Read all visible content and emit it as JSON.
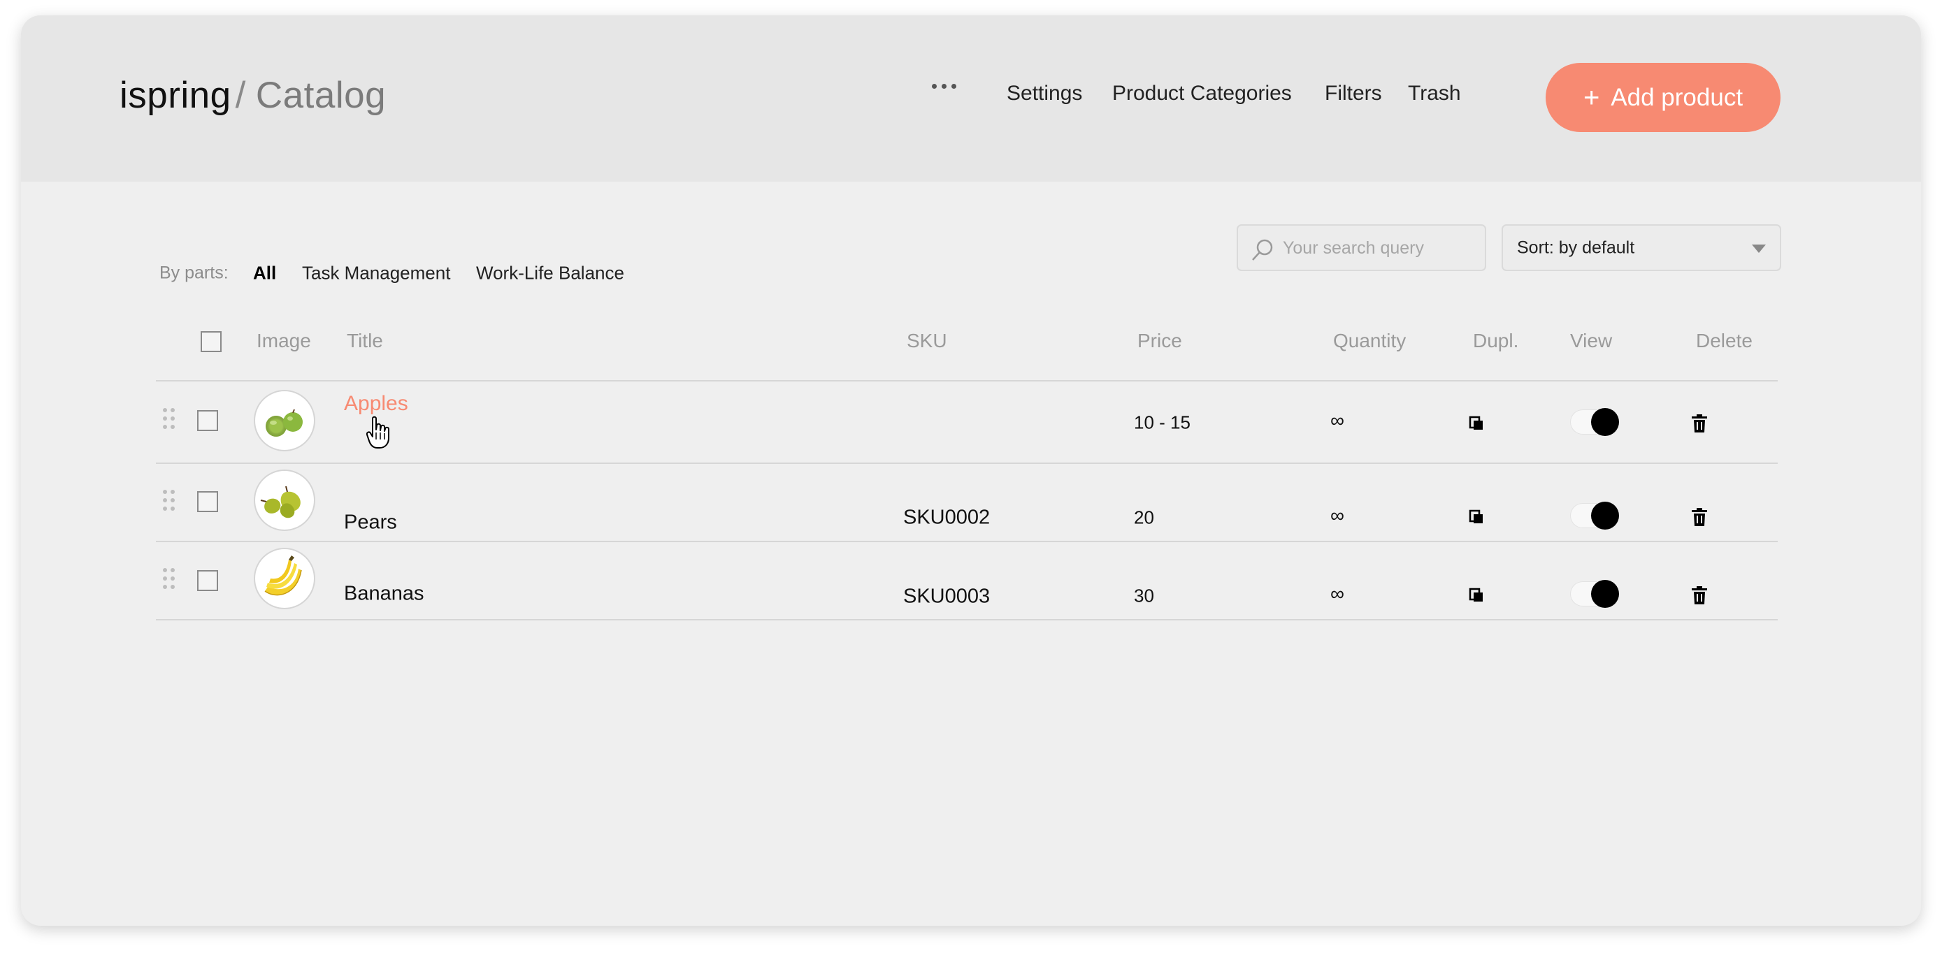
{
  "header": {
    "brand": "ispring",
    "separator": "/",
    "page_title": "Catalog",
    "more_icon": "more-dots-icon",
    "nav": [
      "Settings",
      "Product Categories",
      "Filters",
      "Trash"
    ],
    "add_button": {
      "icon": "plus-icon",
      "label": "Add product"
    }
  },
  "filters": {
    "label": "By parts:",
    "items": [
      {
        "label": "All",
        "active": true
      },
      {
        "label": "Task Management",
        "active": false
      },
      {
        "label": "Work-Life Balance",
        "active": false
      }
    ]
  },
  "search": {
    "icon": "search-icon",
    "placeholder": "Your search query",
    "value": ""
  },
  "sort": {
    "value": "Sort: by default"
  },
  "table": {
    "columns": [
      "Image",
      "Title",
      "SKU",
      "Price",
      "Quantity",
      "Dupl.",
      "View",
      "Delete"
    ],
    "rows": [
      {
        "image": "apples-photo",
        "title": "Apples",
        "sku": "",
        "price": "10 - 15",
        "quantity": "∞",
        "view_on": true,
        "hover": true
      },
      {
        "image": "pears-photo",
        "title": "Pears",
        "sku": "SKU0002",
        "price": "20",
        "quantity": "∞",
        "view_on": true,
        "hover": false
      },
      {
        "image": "bananas-photo",
        "title": "Bananas",
        "sku": "SKU0003",
        "price": "30",
        "quantity": "∞",
        "view_on": true,
        "hover": false
      }
    ]
  },
  "colors": {
    "accent": "#f78a72",
    "header_bg": "#e6e6e6",
    "content_bg": "#efefef"
  }
}
